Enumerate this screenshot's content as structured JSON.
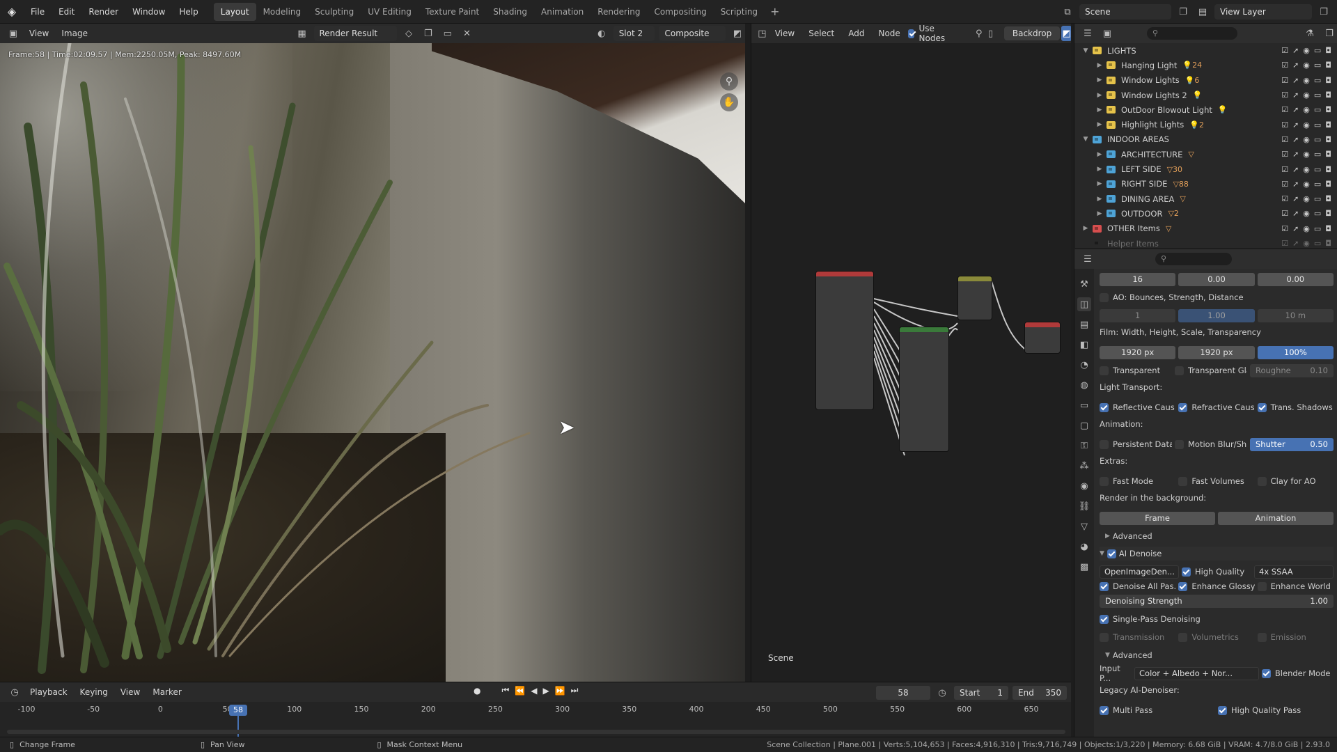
{
  "menu": [
    "File",
    "Edit",
    "Render",
    "Window",
    "Help"
  ],
  "workspaces": [
    {
      "label": "Layout",
      "active": true
    },
    {
      "label": "Modeling",
      "active": false
    },
    {
      "label": "Sculpting",
      "active": false
    },
    {
      "label": "UV Editing",
      "active": false
    },
    {
      "label": "Texture Paint",
      "active": false
    },
    {
      "label": "Shading",
      "active": false
    },
    {
      "label": "Animation",
      "active": false
    },
    {
      "label": "Rendering",
      "active": false
    },
    {
      "label": "Compositing",
      "active": false
    },
    {
      "label": "Scripting",
      "active": false
    }
  ],
  "top_right": {
    "scene": "Scene",
    "view_layer": "View Layer"
  },
  "image_editor": {
    "view": "View",
    "image": "Image",
    "image_name": "Render Result",
    "slot": "Slot 2",
    "pass": "Composite",
    "frame_info": "Frame:58 | Time:02:09.57 | Mem:2250.05M, Peak: 8497.60M"
  },
  "node_editor": {
    "menus": [
      "View",
      "Select",
      "Add",
      "Node"
    ],
    "use_nodes": "Use Nodes",
    "backdrop": "Backdrop",
    "scene_label": "Scene"
  },
  "outliner": {
    "rows": [
      {
        "label": "LIGHTS",
        "depth": 0,
        "color": "#e6c34a",
        "expanded": true,
        "badge": ""
      },
      {
        "label": "Hanging Light",
        "depth": 1,
        "color": "#e6c34a",
        "expanded": false,
        "badge": "💡24"
      },
      {
        "label": "Window Lights",
        "depth": 1,
        "color": "#e6c34a",
        "expanded": false,
        "badge": "💡6"
      },
      {
        "label": "Window Lights 2",
        "depth": 1,
        "color": "#e6c34a",
        "expanded": false,
        "badge": "💡"
      },
      {
        "label": "OutDoor Blowout Light",
        "depth": 1,
        "color": "#e6c34a",
        "expanded": false,
        "badge": "💡"
      },
      {
        "label": "Highlight Lights",
        "depth": 1,
        "color": "#e6c34a",
        "expanded": false,
        "badge": "💡2"
      },
      {
        "label": "INDOOR AREAS",
        "depth": 0,
        "color": "#4ea3d6",
        "expanded": true,
        "badge": ""
      },
      {
        "label": "ARCHITECTURE",
        "depth": 1,
        "color": "#4ea3d6",
        "expanded": false,
        "badge": "▽"
      },
      {
        "label": "LEFT SIDE",
        "depth": 1,
        "color": "#4ea3d6",
        "expanded": false,
        "badge": "▽30"
      },
      {
        "label": "RIGHT SIDE",
        "depth": 1,
        "color": "#4ea3d6",
        "expanded": false,
        "badge": "▽88"
      },
      {
        "label": "DINING AREA",
        "depth": 1,
        "color": "#4ea3d6",
        "expanded": false,
        "badge": "▽"
      },
      {
        "label": "OUTDOOR",
        "depth": 1,
        "color": "#4ea3d6",
        "expanded": false,
        "badge": "▽2"
      },
      {
        "label": "OTHER Items",
        "depth": 0,
        "color": "#d64e4e",
        "expanded": false,
        "badge": "▽"
      },
      {
        "label": "Helper Items",
        "depth": 0,
        "color": "",
        "expanded": false,
        "badge": "",
        "dim": true
      }
    ]
  },
  "properties": {
    "row1": [
      "16",
      "0.00",
      "0.00"
    ],
    "ao_label": "AO: Bounces, Strength, Distance",
    "row_ao": [
      "1",
      "1.00",
      "10 m"
    ],
    "film_label": "Film: Width, Height, Scale, Transparency",
    "row_film": [
      "1920 px",
      "1920 px",
      "100%"
    ],
    "transparent": "Transparent",
    "transparent_glass": "Transparent Gla...",
    "roughness": "Roughne",
    "roughness_val": "0.10",
    "light_transport": "Light Transport:",
    "reflective": "Reflective Caus...",
    "refractive": "Refractive Caus...",
    "trans_shadows": "Trans. Shadows",
    "animation": "Animation:",
    "persistent": "Persistent Data",
    "motion_blur": "Motion Blur/Shu...",
    "shutter": "Shutter",
    "shutter_val": "0.50",
    "extras": "Extras:",
    "fast_mode": "Fast Mode",
    "fast_volumes": "Fast Volumes",
    "clay_ao": "Clay for AO",
    "render_bg": "Render in the background:",
    "frame_btn": "Frame",
    "anim_btn": "Animation",
    "advanced": "Advanced",
    "ai_denoise": "AI Denoise",
    "denoiser": "OpenImageDen...",
    "high_quality": "High Quality",
    "ssaa": "4x SSAA",
    "denoise_all": "Denoise All Pas...",
    "enhance_glossy": "Enhance Glossy",
    "enhance_world": "Enhance World ...",
    "denoise_strength": "Denoising Strength",
    "denoise_strength_val": "1.00",
    "single_pass": "Single-Pass Denoising",
    "transmission": "Transmission",
    "volumetrics": "Volumetrics",
    "emission": "Emission",
    "advanced2": "Advanced",
    "input_p": "Input P...",
    "input_val": "Color + Albedo + Nor...",
    "blender_mode": "Blender Mode",
    "legacy": "Legacy AI-Denoiser:",
    "multi_pass": "Multi Pass",
    "high_quality_pass": "High Quality Pass"
  },
  "timeline": {
    "menus": [
      "Playback",
      "Keying",
      "View",
      "Marker"
    ],
    "current": "58",
    "start_label": "Start",
    "start": "1",
    "end_label": "End",
    "end": "350",
    "ticks": [
      "-100",
      "-50",
      "0",
      "50",
      "100",
      "150",
      "200",
      "250",
      "300",
      "350",
      "400",
      "450",
      "500",
      "550",
      "600",
      "650"
    ],
    "playhead": "58"
  },
  "status": {
    "change_frame": "Change Frame",
    "pan_view": "Pan View",
    "mask_menu": "Mask Context Menu",
    "stats": "Scene Collection | Plane.001 | Verts:5,104,653 | Faces:4,916,310 | Tris:9,716,749 | Objects:1/3,220 | Memory: 6.68 GiB | VRAM: 4.7/8.0 GiB | 2.93.0"
  }
}
